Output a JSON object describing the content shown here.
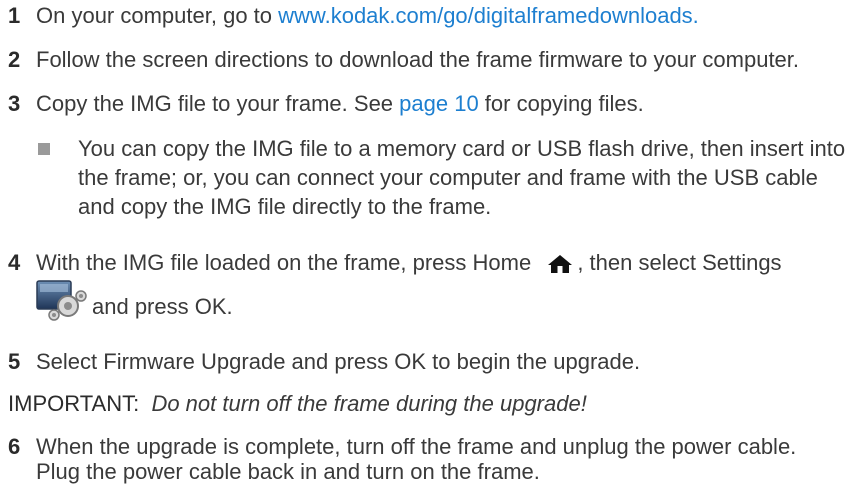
{
  "steps": [
    {
      "num": "1",
      "text": "On your computer, go to ",
      "link": "www.kodak.com/go/digitalframedownloads."
    },
    {
      "num": "2",
      "text": "Follow the screen directions to download the frame firmware to your computer."
    },
    {
      "num": "3",
      "text_before": "Copy the IMG file to your frame. See ",
      "link": "page 10",
      "text_after": " for copying files."
    },
    {
      "num": "4",
      "line1_before": "With the IMG file loaded on the frame, press Home ",
      "line1_after": ", then select Settings",
      "line2": "and press OK."
    },
    {
      "num": "5",
      "text": "Select Firmware Upgrade and press OK to begin the upgrade."
    },
    {
      "num": "6",
      "line1": "When the upgrade is complete, turn off the frame and unplug the power cable.",
      "line2": "Plug the power cable back in and turn on the frame."
    }
  ],
  "bullet": {
    "lines": [
      "You can copy the IMG file to a memory card or USB flash drive, then insert into",
      "the frame; or, you can connect your computer and frame with the USB cable",
      "and copy the IMG file directly to the frame."
    ]
  },
  "important": {
    "label": "IMPORTANT:",
    "text": "Do not turn off the frame during the upgrade!"
  },
  "icons": {
    "home": "home-icon",
    "settings": "settings-icon"
  }
}
